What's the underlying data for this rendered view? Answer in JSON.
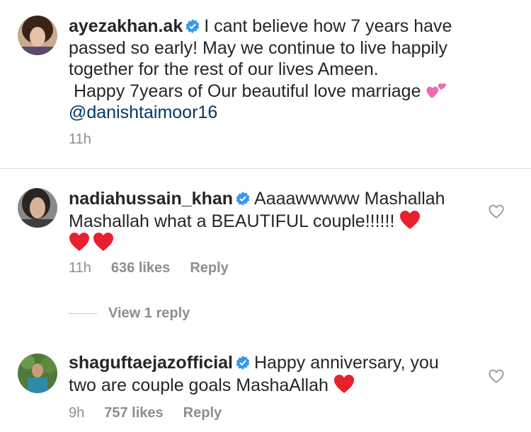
{
  "comments": [
    {
      "username": "ayezakhan.ak",
      "line1": "I cant believe how 7 years have",
      "line2": "passed so early! May we continue to live happily",
      "line3": "together for the rest of our lives Ameen.",
      "line4": " Happy 7years of Our beautiful love marriage ",
      "mention": "@danishtaimoor16",
      "time": "11h"
    },
    {
      "username": "nadiahussain_khan",
      "line1": "Aaaawwwww Mashallah",
      "line2": "Mashallah what a BEAUTIFUL couple!!!!!! ",
      "time": "11h",
      "likes": "636 likes",
      "reply_label": "Reply",
      "view_replies": "View 1 reply"
    },
    {
      "username": "shaguftaejazofficial",
      "line1": "Happy anniversary, you",
      "line2": "two are couple goals MashaAllah ",
      "time": "9h",
      "likes": "757 likes",
      "reply_label": "Reply"
    }
  ],
  "colors": {
    "text": "#262626",
    "meta": "#8e8e8e",
    "mention": "#00376b",
    "verified": "#3897f0",
    "heart_emoji": "#e8202e",
    "divider": "#dbdbdb"
  },
  "icons": [
    "verified-badge-icon",
    "red-heart-emoji",
    "two-hearts-emoji",
    "like-heart-icon"
  ]
}
